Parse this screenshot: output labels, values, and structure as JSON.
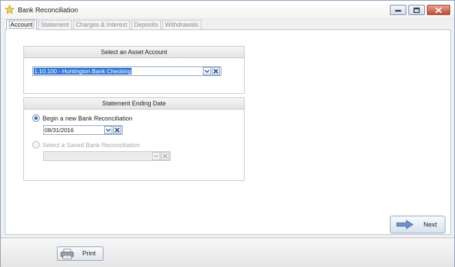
{
  "window": {
    "title": "Bank Reconciliation",
    "icon": "star-icon"
  },
  "tabs": [
    {
      "label": "Account",
      "active": true
    },
    {
      "label": "Statement",
      "active": false
    },
    {
      "label": "Charges & Interest",
      "active": false
    },
    {
      "label": "Deposits",
      "active": false
    },
    {
      "label": "Withdrawals",
      "active": false
    }
  ],
  "asset_account": {
    "heading": "Select an Asset Account",
    "value": "1.10.100 - Huntington Bank Checking"
  },
  "statement_ending": {
    "heading": "Statement Ending Date",
    "begin_new_label": "Begin a new Bank Reconciliation",
    "begin_new_checked": true,
    "date_value": "08/31/2016",
    "saved_label": "Select a Saved Bank Reconciliation",
    "saved_enabled": false,
    "saved_value": ""
  },
  "buttons": {
    "next": "Next",
    "print": "Print"
  },
  "colors": {
    "selection": "#3779d6",
    "border_accent": "#8ea3c2",
    "close_button": "#c24a33"
  }
}
